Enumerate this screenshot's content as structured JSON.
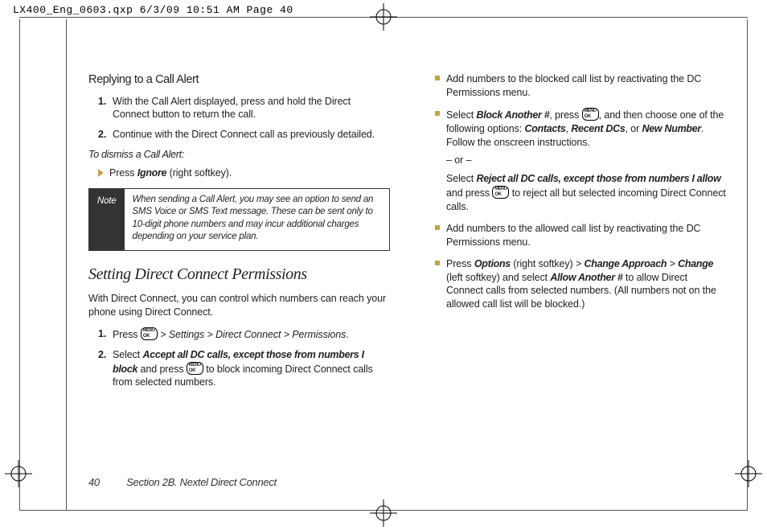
{
  "print_header": "LX400_Eng_0603.qxp  6/3/09  10:51 AM  Page 40",
  "footer": {
    "page_number": "40",
    "section": "Section 2B. Nextel Direct Connect"
  },
  "left": {
    "heading1": "Replying to a Call Alert",
    "step1": "With the Call Alert displayed, press and hold the Direct Connect button to return the call.",
    "step2": "Continue with the Direct Connect call as previously detailed.",
    "dismiss_label": "To dismiss a Call Alert:",
    "dismiss_pre": "Press ",
    "dismiss_bold": "Ignore",
    "dismiss_post": " (right softkey).",
    "note_label": "Note",
    "note_body": "When sending a Call Alert, you may see an option to send an SMS Voice or SMS Text message. These can be sent only to 10-digit phone numbers and may incur additional charges depending on your service plan.",
    "heading2": "Setting Direct Connect Permissions",
    "intro2": "With Direct Connect, you can control which numbers can reach your phone using Direct Connect.",
    "perm1_pre": "Press ",
    "perm1_path": " > Settings > Direct Connect > Permissions",
    "perm1_post": ".",
    "perm2_pre": "Select ",
    "perm2_bold": "Accept all DC calls, except those from numbers I block",
    "perm2_mid": " and press ",
    "perm2_post": " to block incoming Direct Connect calls from selected numbers."
  },
  "right": {
    "b1": "Add numbers to the blocked call list by reactivating the DC Permissions menu.",
    "b2_pre": "Select ",
    "b2_bold1": "Block Another #",
    "b2_mid1": ", press ",
    "b2_mid2": ", and then choose one of the following options: ",
    "b2_opt1": "Contacts",
    "b2_optsep": ", ",
    "b2_opt2": "Recent DCs",
    "b2_optor": ", or ",
    "b2_opt3": "New Number",
    "b2_post": ". Follow the onscreen instructions.",
    "orlabel": "– or –",
    "b2b_pre": "Select ",
    "b2b_bold": "Reject all DC calls, except those from numbers I allow",
    "b2b_mid": " and press ",
    "b2b_post": " to reject all but selected incoming Direct Connect calls.",
    "b3": "Add numbers to the allowed call list by reactivating the DC Permissions menu.",
    "b4_pre": "Press ",
    "b4_bold1": "Options",
    "b4_mid1": " (right softkey) ",
    "b4_gt1": ">",
    "b4_bold2": "Change Approach",
    "b4_gt2": ">",
    "b4_bold3": "Change",
    "b4_mid2": " (left softkey) and select ",
    "b4_bold4": "Allow Another #",
    "b4_post": " to allow Direct Connect calls from selected numbers. (All numbers not on the allowed call list will be blocked.)"
  }
}
